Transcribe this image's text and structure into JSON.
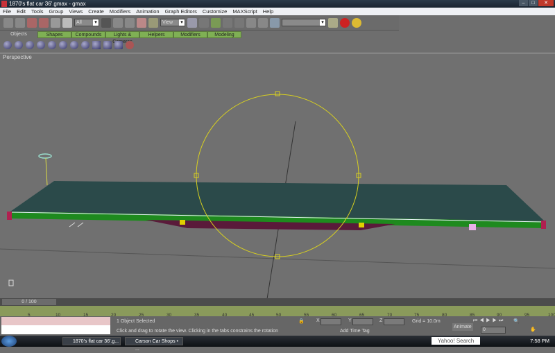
{
  "window": {
    "title": "1870's flat car 36'.gmax - gmax"
  },
  "menu": [
    "File",
    "Edit",
    "Tools",
    "Group",
    "Views",
    "Create",
    "Modifiers",
    "Animation",
    "Graph Editors",
    "Customize",
    "MAXScript",
    "Help"
  ],
  "toolbar": {
    "selection_filter": "All",
    "ref_coord": "View",
    "named_selection": ""
  },
  "tabs": [
    "Objects",
    "Shapes",
    "Compounds",
    "Lights & Cameras",
    "Helpers",
    "Modifiers",
    "Modeling"
  ],
  "viewport": {
    "label": "Perspective"
  },
  "timeline": {
    "frame": "0 / 100",
    "ticks": [
      "5",
      "10",
      "15",
      "20",
      "25",
      "30",
      "35",
      "40",
      "45",
      "50",
      "55",
      "60",
      "65",
      "70",
      "75",
      "80",
      "85",
      "90",
      "95",
      "100"
    ]
  },
  "status": {
    "selected": "1 Object Selected",
    "prompt": "Click and drag to rotate the view.  Clicking in the tabs constrains the rotation",
    "x_label": "X",
    "y_label": "Y",
    "z_label": "Z",
    "grid": "Grid = 10.0m",
    "add_time_tag": "Add Time Tag",
    "animate": "Animate",
    "current_frame": "0"
  },
  "taskbar": {
    "tasks": [
      "1870's flat car 36'.g...",
      "Carson Car Shops • ..."
    ],
    "search": "Yahoo! Search",
    "clock": "7:58 PM"
  },
  "colors": {
    "deck": "#2b4a4a",
    "side": "#1e8a1e",
    "gizmo": "#d8d020",
    "ruler": "#8a9a5b",
    "tab": "#7fb054"
  }
}
